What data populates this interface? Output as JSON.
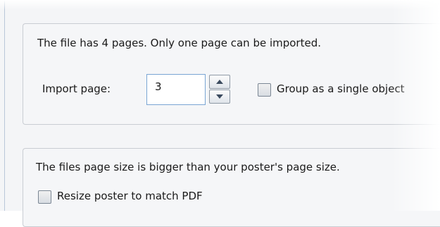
{
  "import_section": {
    "message": "The file has 4 pages. Only one page can be imported.",
    "import_page_label": "Import page:",
    "import_page_value": "3",
    "group_label": "Group as a single object",
    "group_checked": false
  },
  "size_section": {
    "message": "The files page size is bigger than your poster's page size.",
    "resize_label": "Resize poster to match PDF",
    "resize_checked": false
  }
}
